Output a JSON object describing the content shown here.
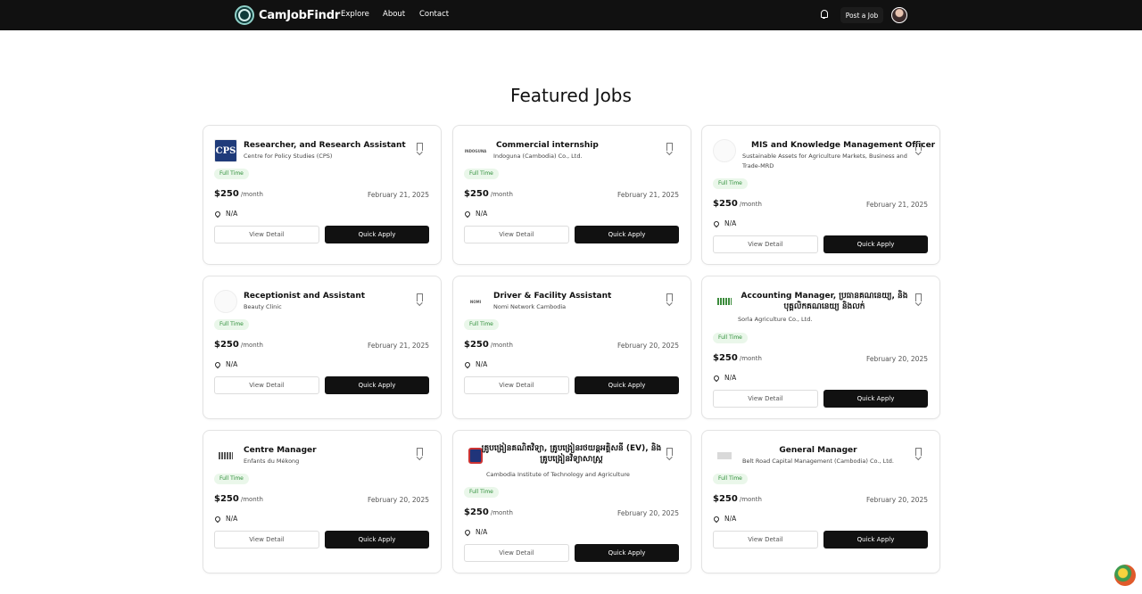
{
  "nav": {
    "brand": "CamJobFindr",
    "links": [
      "Explore",
      "About",
      "Contact"
    ],
    "post_job": "Post a Job"
  },
  "heading": "Featured Jobs",
  "jobs": [
    {
      "title": "Researcher, and Research Assistant",
      "company": "Centre for Policy Studies (CPS)",
      "type": "Full Time",
      "salary": "$250",
      "per": "/month",
      "date": "February 21, 2025",
      "location": "N/A",
      "logo": "CPS"
    },
    {
      "title": "Commercial internship",
      "company": "Indoguna (Cambodia) Co., Ltd.",
      "type": "Full Time",
      "salary": "$250",
      "per": "/month",
      "date": "February 21, 2025",
      "location": "N/A",
      "logo": "INDOGUNA"
    },
    {
      "title": "MIS and Knowledge Management Officer",
      "company": "Sustainable Assets for Agriculture Markets, Business and Trade-MRD",
      "type": "Full Time",
      "salary": "$250",
      "per": "/month",
      "date": "February 21, 2025",
      "location": "N/A",
      "logo": ""
    },
    {
      "title": "Receptionist and Assistant",
      "company": "Beauty Clinic",
      "type": "Full Time",
      "salary": "$250",
      "per": "/month",
      "date": "February 21, 2025",
      "location": "N/A",
      "logo": ""
    },
    {
      "title": "Driver & Facility Assistant",
      "company": "Nomi Network Cambodia",
      "type": "Full Time",
      "salary": "$250",
      "per": "/month",
      "date": "February 20, 2025",
      "location": "N/A",
      "logo": "NOMI"
    },
    {
      "title": "Accounting Manager, ប្រធានគណនេយ្យ, និង បុគ្គលិកគណនេយ្យ និងលក់",
      "company": "Sorla Agriculture Co., Ltd.",
      "type": "Full Time",
      "salary": "$250",
      "per": "/month",
      "date": "February 20, 2025",
      "location": "N/A",
      "logo": ""
    },
    {
      "title": "Centre Manager",
      "company": "Enfants du Mékong",
      "type": "Full Time",
      "salary": "$250",
      "per": "/month",
      "date": "February 20, 2025",
      "location": "N/A",
      "logo": ""
    },
    {
      "title": "គ្រូបង្រៀនគណិតវិទ្យា, គ្រូបង្រៀនរថយន្តអគ្គិសនី (EV), និង គ្រូបង្រៀនវិទ្យាសាស្ត្រ",
      "company": "Cambodia Institute of Technology and Agriculture",
      "type": "Full Time",
      "salary": "$250",
      "per": "/month",
      "date": "February 20, 2025",
      "location": "N/A",
      "logo": ""
    },
    {
      "title": "General Manager",
      "company": "Belt Road Capital Management (Cambodia) Co., Ltd.",
      "type": "Full Time",
      "salary": "$250",
      "per": "/month",
      "date": "February 20, 2025",
      "location": "N/A",
      "logo": ""
    }
  ],
  "buttons": {
    "detail": "View Detail",
    "apply": "Quick Apply"
  }
}
